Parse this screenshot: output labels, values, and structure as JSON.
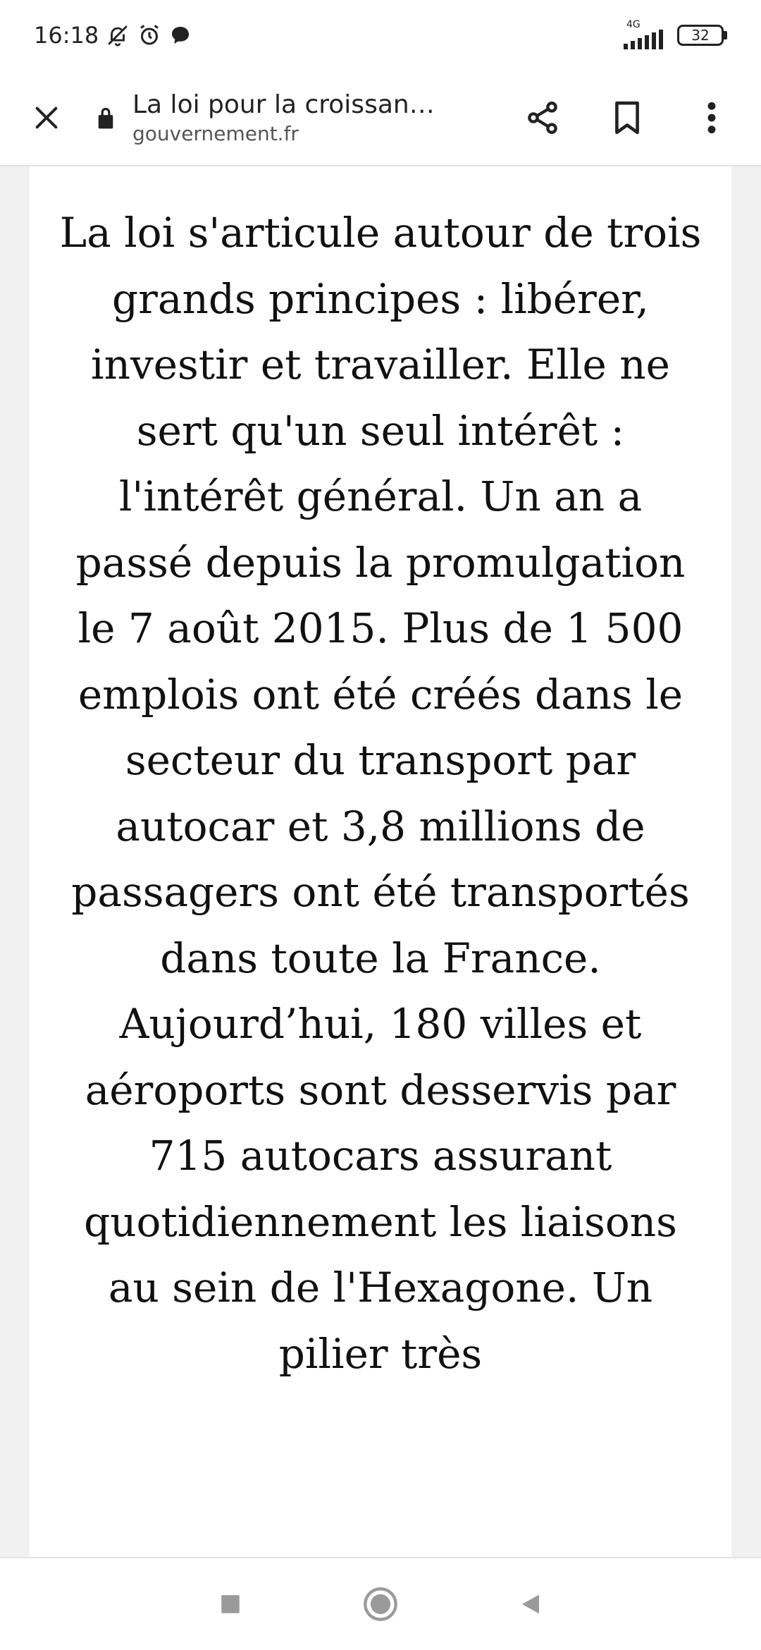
{
  "status_bar": {
    "time": "16:18",
    "network": "4G",
    "battery": "32",
    "icons": [
      "bell-off-icon",
      "alarm-icon",
      "chat-bubble-icon",
      "signal-icon",
      "battery-icon"
    ]
  },
  "toolbar": {
    "title": "La loi pour la croissan…",
    "domain": "gouvernement.fr",
    "icons": [
      "close-icon",
      "lock-icon",
      "share-icon",
      "bookmark-icon",
      "more-vert-icon"
    ]
  },
  "article": {
    "text": "La loi s'articule autour de trois grands principes : libérer, investir et travailler. Elle ne sert qu'un seul intérêt : l'intérêt général. Un an a passé depuis la promulgation le 7 août 2015. Plus de 1 500 emplois ont été créés dans le secteur du transport par autocar et 3,8 millions de passagers ont été transportés dans toute la France. Aujourd’hui, 180 villes et aéroports sont desservis par 715 autocars assurant quotidiennement les liaisons au sein de l'Hexagone. Un pilier très"
  },
  "nav_bar": {
    "icons": [
      "recents-square-icon",
      "home-circle-icon",
      "back-triangle-icon"
    ]
  },
  "colors": {
    "background": "#f1f1f1",
    "surface": "#ffffff",
    "text": "#111111"
  }
}
